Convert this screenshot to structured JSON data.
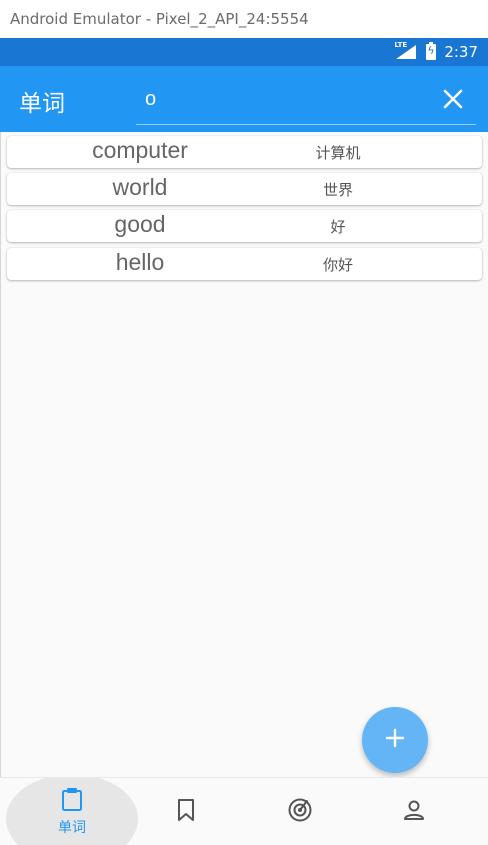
{
  "window": {
    "title": "Android Emulator - Pixel_2_API_24:5554"
  },
  "status_bar": {
    "network": "LTE",
    "time": "2:37"
  },
  "app_bar": {
    "title": "单词",
    "search_value": "o",
    "close_icon": "close-icon"
  },
  "words": [
    {
      "english": "computer",
      "chinese": "计算机"
    },
    {
      "english": "world",
      "chinese": "世界"
    },
    {
      "english": "good",
      "chinese": "好"
    },
    {
      "english": "hello",
      "chinese": "你好"
    }
  ],
  "fab": {
    "icon": "plus-icon"
  },
  "bottom_nav": {
    "items": [
      {
        "icon": "clipboard-icon",
        "label": "单词",
        "active": true
      },
      {
        "icon": "bookmark-icon",
        "label": "",
        "active": false
      },
      {
        "icon": "radar-icon",
        "label": "",
        "active": false
      },
      {
        "icon": "person-icon",
        "label": "",
        "active": false
      }
    ]
  },
  "colors": {
    "status_bar": "#1976d2",
    "app_bar": "#2196f3",
    "fab": "#64b5f6",
    "nav_active": "#2196f3",
    "nav_inactive": "#555555"
  }
}
